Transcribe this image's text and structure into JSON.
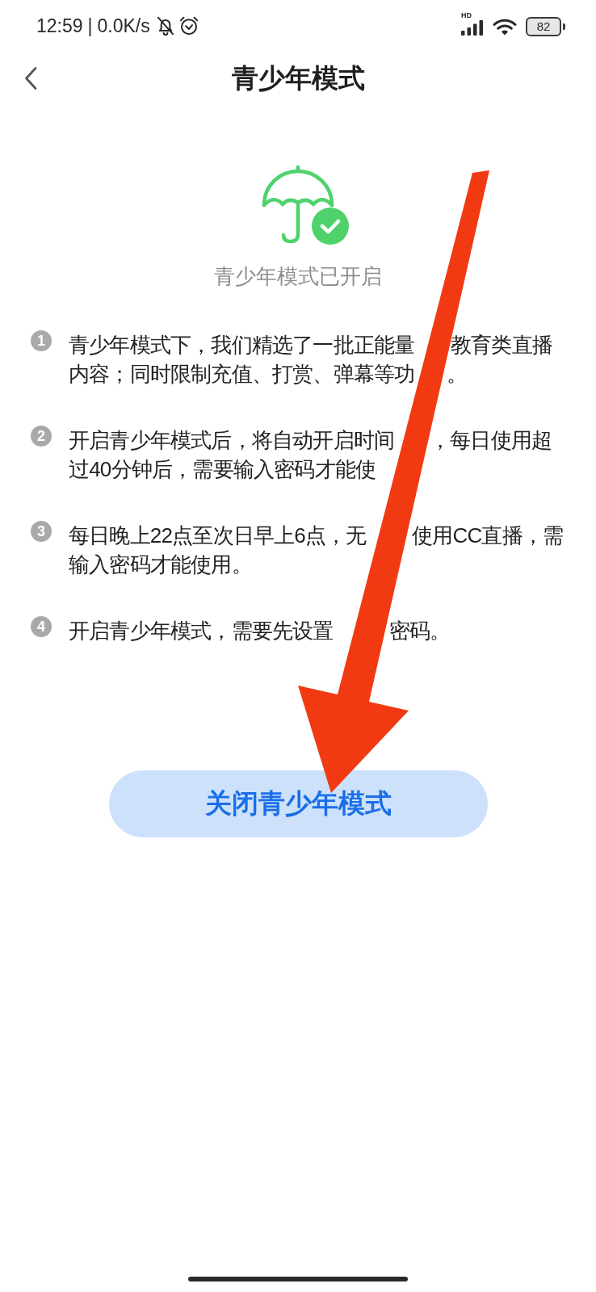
{
  "status_bar": {
    "time": "12:59",
    "separator": "|",
    "speed": "0.0K/s",
    "network_type": "HD",
    "battery": "82"
  },
  "header": {
    "title": "青少年模式"
  },
  "status": {
    "text": "青少年模式已开启"
  },
  "items": [
    {
      "number": "1",
      "lines": [
        [
          "青少年模式下，我们精选了一批正能量",
          "教育类直播"
        ],
        [
          "内容；同时限制充值、打赏、弹幕等功",
          "。"
        ]
      ]
    },
    {
      "number": "2",
      "lines": [
        [
          "开启青少年模式后，将自动开启时间",
          "，每日使用超"
        ],
        [
          "过40分钟后，需要输入密码才能使"
        ]
      ]
    },
    {
      "number": "3",
      "lines": [
        [
          "每日晚上22点至次日早上6点，无",
          "使用CC直播，需"
        ],
        [
          "输入密码才能使用。"
        ]
      ]
    },
    {
      "number": "4",
      "lines": [
        [
          "开启青少年模式，需要先设置",
          "密码。"
        ]
      ]
    }
  ],
  "button": {
    "label": "关闭青少年模式"
  }
}
